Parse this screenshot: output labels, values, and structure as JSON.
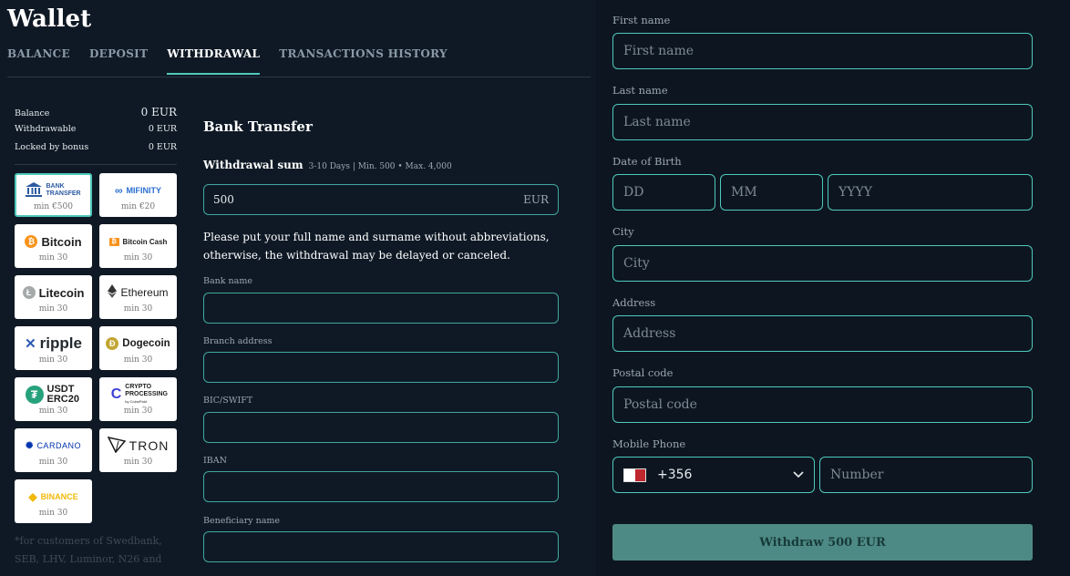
{
  "header": {
    "title": "Wallet",
    "tabs": [
      {
        "label": "BALANCE"
      },
      {
        "label": "DEPOSIT"
      },
      {
        "label": "WITHDRAWAL",
        "active": true
      },
      {
        "label": "TRANSACTIONS HISTORY"
      }
    ]
  },
  "balance": {
    "rows": [
      {
        "label": "Balance",
        "value": "0 EUR"
      },
      {
        "label": "Withdrawable",
        "value": "0 EUR"
      },
      {
        "label": "Locked by bonus",
        "value": "0 EUR"
      }
    ]
  },
  "methods": [
    {
      "name": "BANK TRANSFER",
      "min": "min €500",
      "icon": "bank-icon",
      "color": "#2c5aa0",
      "selected": true
    },
    {
      "name": "MIFINITY",
      "min": "min €20",
      "icon": "mifinity-icon",
      "color": "#2a6fd1"
    },
    {
      "name": "Bitcoin",
      "min": "min 30",
      "icon": "bitcoin-icon",
      "color": "#f7931a"
    },
    {
      "name": "Bitcoin Cash",
      "min": "min 30",
      "icon": "bitcoin-cash-icon",
      "color": "#f7931a"
    },
    {
      "name": "Litecoin",
      "min": "min 30",
      "icon": "litecoin-icon",
      "color": "#a6a9aa"
    },
    {
      "name": "Ethereum",
      "min": "min 30",
      "icon": "ethereum-icon",
      "color": "#343434"
    },
    {
      "name": "ripple",
      "min": "min 30",
      "icon": "ripple-icon",
      "color": "#23292f"
    },
    {
      "name": "Dogecoin",
      "min": "min 30",
      "icon": "dogecoin-icon",
      "color": "#c2a633"
    },
    {
      "name": "USDT ERC20",
      "min": "min 30",
      "icon": "tether-icon",
      "color": "#26a17b"
    },
    {
      "name": "CRYPTO PROCESSING",
      "sub": "by CoinsPaid",
      "min": "min 30",
      "icon": "cryptoprocessing-icon",
      "color": "#3b3fd8"
    },
    {
      "name": "CARDANO",
      "min": "min 30",
      "icon": "cardano-icon",
      "color": "#0033ad"
    },
    {
      "name": "TRON",
      "min": "min 30",
      "icon": "tron-icon",
      "color": "#1a1a1a"
    },
    {
      "name": "BINANCE",
      "min": "min 30",
      "icon": "binance-icon",
      "color": "#f0b90b"
    }
  ],
  "note": "*for customers of Swedbank, SEB, LHV, Luminor, N26 and ...",
  "form": {
    "heading": "Bank Transfer",
    "sum_label": "Withdrawal sum",
    "sum_hint": "3-10 Days | Min. 500 • Max. 4,000",
    "sum_value": "500",
    "sum_currency": "EUR",
    "message": "Please put your full name and surname without abbreviations, otherwise, the withdrawal may be delayed or canceled.",
    "fields": [
      {
        "label": "Bank name"
      },
      {
        "label": "Branch address"
      },
      {
        "label": "BIC/SWIFT"
      },
      {
        "label": "IBAN"
      },
      {
        "label": "Beneficiary name"
      }
    ]
  },
  "personal": {
    "first_name_label": "First name",
    "first_name_placeholder": "First name",
    "last_name_label": "Last name",
    "last_name_placeholder": "Last name",
    "dob_label": "Date of Birth",
    "dob_day": "DD",
    "dob_month": "MM",
    "dob_year": "YYYY",
    "city_label": "City",
    "city_placeholder": "City",
    "address_label": "Address",
    "address_placeholder": "Address",
    "postal_label": "Postal code",
    "postal_placeholder": "Postal code",
    "phone_label": "Mobile Phone",
    "phone_code": "+356",
    "phone_placeholder": "Number"
  },
  "submit_label": "Withdraw 500 EUR"
}
